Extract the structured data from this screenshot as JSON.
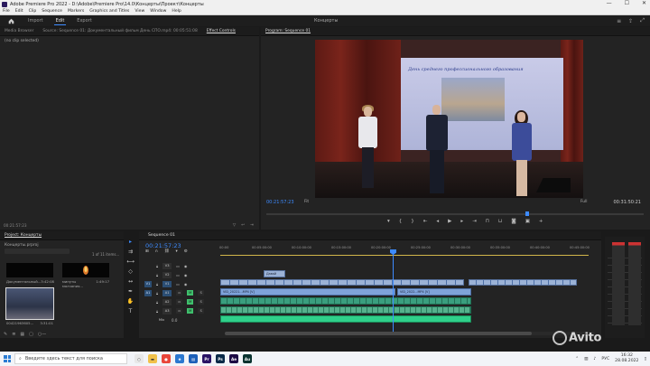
{
  "window": {
    "title": "Adobe Premiere Pro 2022 - D:\\Adobe\\Premiere Pro\\14.0\\Концерты\\Проект\\Концерты",
    "controls": [
      "—",
      "☐",
      "✕"
    ]
  },
  "menu": [
    "File",
    "Edit",
    "Clip",
    "Sequence",
    "Markers",
    "Graphics and Titles",
    "View",
    "Window",
    "Help"
  ],
  "workspace": {
    "tabs": [
      "Import",
      "Edit",
      "Export"
    ],
    "active_tab": "Edit",
    "project_title": "Концерты"
  },
  "source_panel": {
    "tabs": [
      "Media Browser",
      "Source: Sequence 01: Документальный фильм День СПО.mp4: 00:05:51:08",
      "Effect Controls"
    ],
    "active_tab": "Effect Controls",
    "message": "(no clip selected)",
    "timecode": "00:21:57:23"
  },
  "program_monitor": {
    "title": "Program: Sequence 01",
    "timecode": "00:21:57:23",
    "fit": "Fit",
    "resolution": "Full",
    "duration": "00:31:50:21",
    "video_banner_text": "День среднего профессионального образования"
  },
  "project_panel": {
    "tab": "Project: Концерты",
    "project_file": "Концерты.prproj",
    "item_count": "1 of 11 items...",
    "items": [
      {
        "name": "Документальный...",
        "duration": "3:42:08"
      },
      {
        "name": "минуты молчания...",
        "duration": "1:49:17"
      },
      {
        "name": "00421963605...",
        "duration": "3:31:01"
      }
    ]
  },
  "timeline": {
    "tab": "Sequence 01",
    "timecode": "00:21:57:23",
    "ruler": [
      "00:00",
      "00:05:00:00",
      "00:10:00:00",
      "00:15:00:00",
      "00:20:00:00",
      "00:25:00:00",
      "00:30:00:00",
      "00:35:00:00",
      "00:40:00:00",
      "00:45:00:00"
    ],
    "tracks": [
      {
        "id": "V3",
        "src": ""
      },
      {
        "id": "V2",
        "src": ""
      },
      {
        "id": "V1",
        "src": "V1"
      },
      {
        "id": "A1",
        "src": "A1"
      },
      {
        "id": "A2",
        "src": ""
      },
      {
        "id": "A3",
        "src": ""
      },
      {
        "id": "Mix",
        "src": ""
      }
    ],
    "clip_labels": {
      "title": "Давай",
      "v_clip_a": "VID_20221...MP4 [V]",
      "v_clip_b": "VID_2022...MP4 [V]"
    },
    "mix_level": "0.0"
  },
  "taskbar": {
    "search_placeholder": "Введите здесь текст для поиска",
    "apps": [
      {
        "name": "Pr",
        "color": "#2a1465"
      },
      {
        "name": "Ps",
        "color": "#0a2a48"
      },
      {
        "name": "Ae",
        "color": "#1c0a44"
      },
      {
        "name": "Au",
        "color": "#0a3330"
      }
    ],
    "lang": "РУС",
    "time": "16:32",
    "date": "28.08.2022"
  },
  "watermark": "Avito"
}
